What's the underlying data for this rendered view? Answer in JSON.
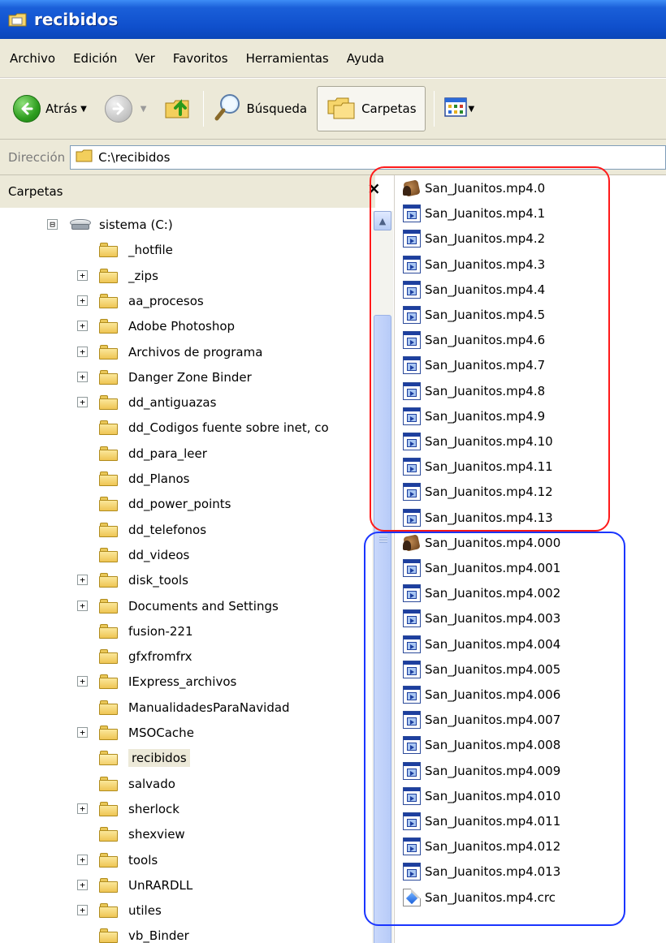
{
  "window": {
    "title": "recibidos"
  },
  "menu": [
    "Archivo",
    "Edición",
    "Ver",
    "Favoritos",
    "Herramientas",
    "Ayuda"
  ],
  "toolbar": {
    "back_label": "Atrás",
    "search_label": "Búsqueda",
    "folders_label": "Carpetas"
  },
  "address": {
    "label": "Dirección",
    "value": "C:\\recibidos"
  },
  "folders_pane": {
    "header": "Carpetas",
    "close_glyph": "×",
    "items": [
      {
        "label": "sistema (C:)",
        "expander": "⊟",
        "type": "drive"
      },
      {
        "label": "_hotfile",
        "expander": "",
        "type": "folder"
      },
      {
        "label": "_zips",
        "expander": "+",
        "type": "folder"
      },
      {
        "label": "aa_procesos",
        "expander": "+",
        "type": "folder"
      },
      {
        "label": "Adobe Photoshop",
        "expander": "+",
        "type": "folder"
      },
      {
        "label": "Archivos de programa",
        "expander": "+",
        "type": "folder"
      },
      {
        "label": "Danger Zone Binder",
        "expander": "+",
        "type": "folder"
      },
      {
        "label": "dd_antiguazas",
        "expander": "+",
        "type": "folder"
      },
      {
        "label": "dd_Codigos fuente sobre inet, co",
        "expander": "",
        "type": "folder"
      },
      {
        "label": "dd_para_leer",
        "expander": "",
        "type": "folder"
      },
      {
        "label": "dd_Planos",
        "expander": "",
        "type": "folder"
      },
      {
        "label": "dd_power_points",
        "expander": "",
        "type": "folder"
      },
      {
        "label": "dd_telefonos",
        "expander": "",
        "type": "folder"
      },
      {
        "label": "dd_videos",
        "expander": "",
        "type": "folder"
      },
      {
        "label": "disk_tools",
        "expander": "+",
        "type": "folder"
      },
      {
        "label": "Documents and Settings",
        "expander": "+",
        "type": "folder"
      },
      {
        "label": "fusion-221",
        "expander": "",
        "type": "folder"
      },
      {
        "label": "gfxfromfrx",
        "expander": "",
        "type": "folder"
      },
      {
        "label": "IExpress_archivos",
        "expander": "+",
        "type": "folder"
      },
      {
        "label": "ManualidadesParaNavidad",
        "expander": "",
        "type": "folder"
      },
      {
        "label": "MSOCache",
        "expander": "+",
        "type": "folder"
      },
      {
        "label": "recibidos",
        "expander": "",
        "type": "folder",
        "selected": true
      },
      {
        "label": "salvado",
        "expander": "",
        "type": "folder"
      },
      {
        "label": "sherlock",
        "expander": "+",
        "type": "folder"
      },
      {
        "label": "shexview",
        "expander": "",
        "type": "folder"
      },
      {
        "label": "tools",
        "expander": "+",
        "type": "folder"
      },
      {
        "label": "UnRARDLL",
        "expander": "+",
        "type": "folder"
      },
      {
        "label": "utiles",
        "expander": "+",
        "type": "folder"
      },
      {
        "label": "vb_Binder",
        "expander": "",
        "type": "folder"
      }
    ]
  },
  "files": [
    {
      "name": "San_Juanitos.mp4.0",
      "icon": "exe-icon"
    },
    {
      "name": "San_Juanitos.mp4.1",
      "icon": "media-file-icon"
    },
    {
      "name": "San_Juanitos.mp4.2",
      "icon": "media-file-icon"
    },
    {
      "name": "San_Juanitos.mp4.3",
      "icon": "media-file-icon"
    },
    {
      "name": "San_Juanitos.mp4.4",
      "icon": "media-file-icon"
    },
    {
      "name": "San_Juanitos.mp4.5",
      "icon": "media-file-icon"
    },
    {
      "name": "San_Juanitos.mp4.6",
      "icon": "media-file-icon"
    },
    {
      "name": "San_Juanitos.mp4.7",
      "icon": "media-file-icon"
    },
    {
      "name": "San_Juanitos.mp4.8",
      "icon": "media-file-icon"
    },
    {
      "name": "San_Juanitos.mp4.9",
      "icon": "media-file-icon"
    },
    {
      "name": "San_Juanitos.mp4.10",
      "icon": "media-file-icon"
    },
    {
      "name": "San_Juanitos.mp4.11",
      "icon": "media-file-icon"
    },
    {
      "name": "San_Juanitos.mp4.12",
      "icon": "media-file-icon"
    },
    {
      "name": "San_Juanitos.mp4.13",
      "icon": "media-file-icon"
    },
    {
      "name": "San_Juanitos.mp4.000",
      "icon": "exe-icon"
    },
    {
      "name": "San_Juanitos.mp4.001",
      "icon": "media-file-icon"
    },
    {
      "name": "San_Juanitos.mp4.002",
      "icon": "media-file-icon"
    },
    {
      "name": "San_Juanitos.mp4.003",
      "icon": "media-file-icon"
    },
    {
      "name": "San_Juanitos.mp4.004",
      "icon": "media-file-icon"
    },
    {
      "name": "San_Juanitos.mp4.005",
      "icon": "media-file-icon"
    },
    {
      "name": "San_Juanitos.mp4.006",
      "icon": "media-file-icon"
    },
    {
      "name": "San_Juanitos.mp4.007",
      "icon": "media-file-icon"
    },
    {
      "name": "San_Juanitos.mp4.008",
      "icon": "media-file-icon"
    },
    {
      "name": "San_Juanitos.mp4.009",
      "icon": "media-file-icon"
    },
    {
      "name": "San_Juanitos.mp4.010",
      "icon": "media-file-icon"
    },
    {
      "name": "San_Juanitos.mp4.011",
      "icon": "media-file-icon"
    },
    {
      "name": "San_Juanitos.mp4.012",
      "icon": "media-file-icon"
    },
    {
      "name": "San_Juanitos.mp4.013",
      "icon": "media-file-icon"
    },
    {
      "name": "San_Juanitos.mp4.crc",
      "icon": "crc-file-icon"
    }
  ],
  "annotations": {
    "group1_color": "#ff1a1a",
    "group2_color": "#1a35ff"
  }
}
